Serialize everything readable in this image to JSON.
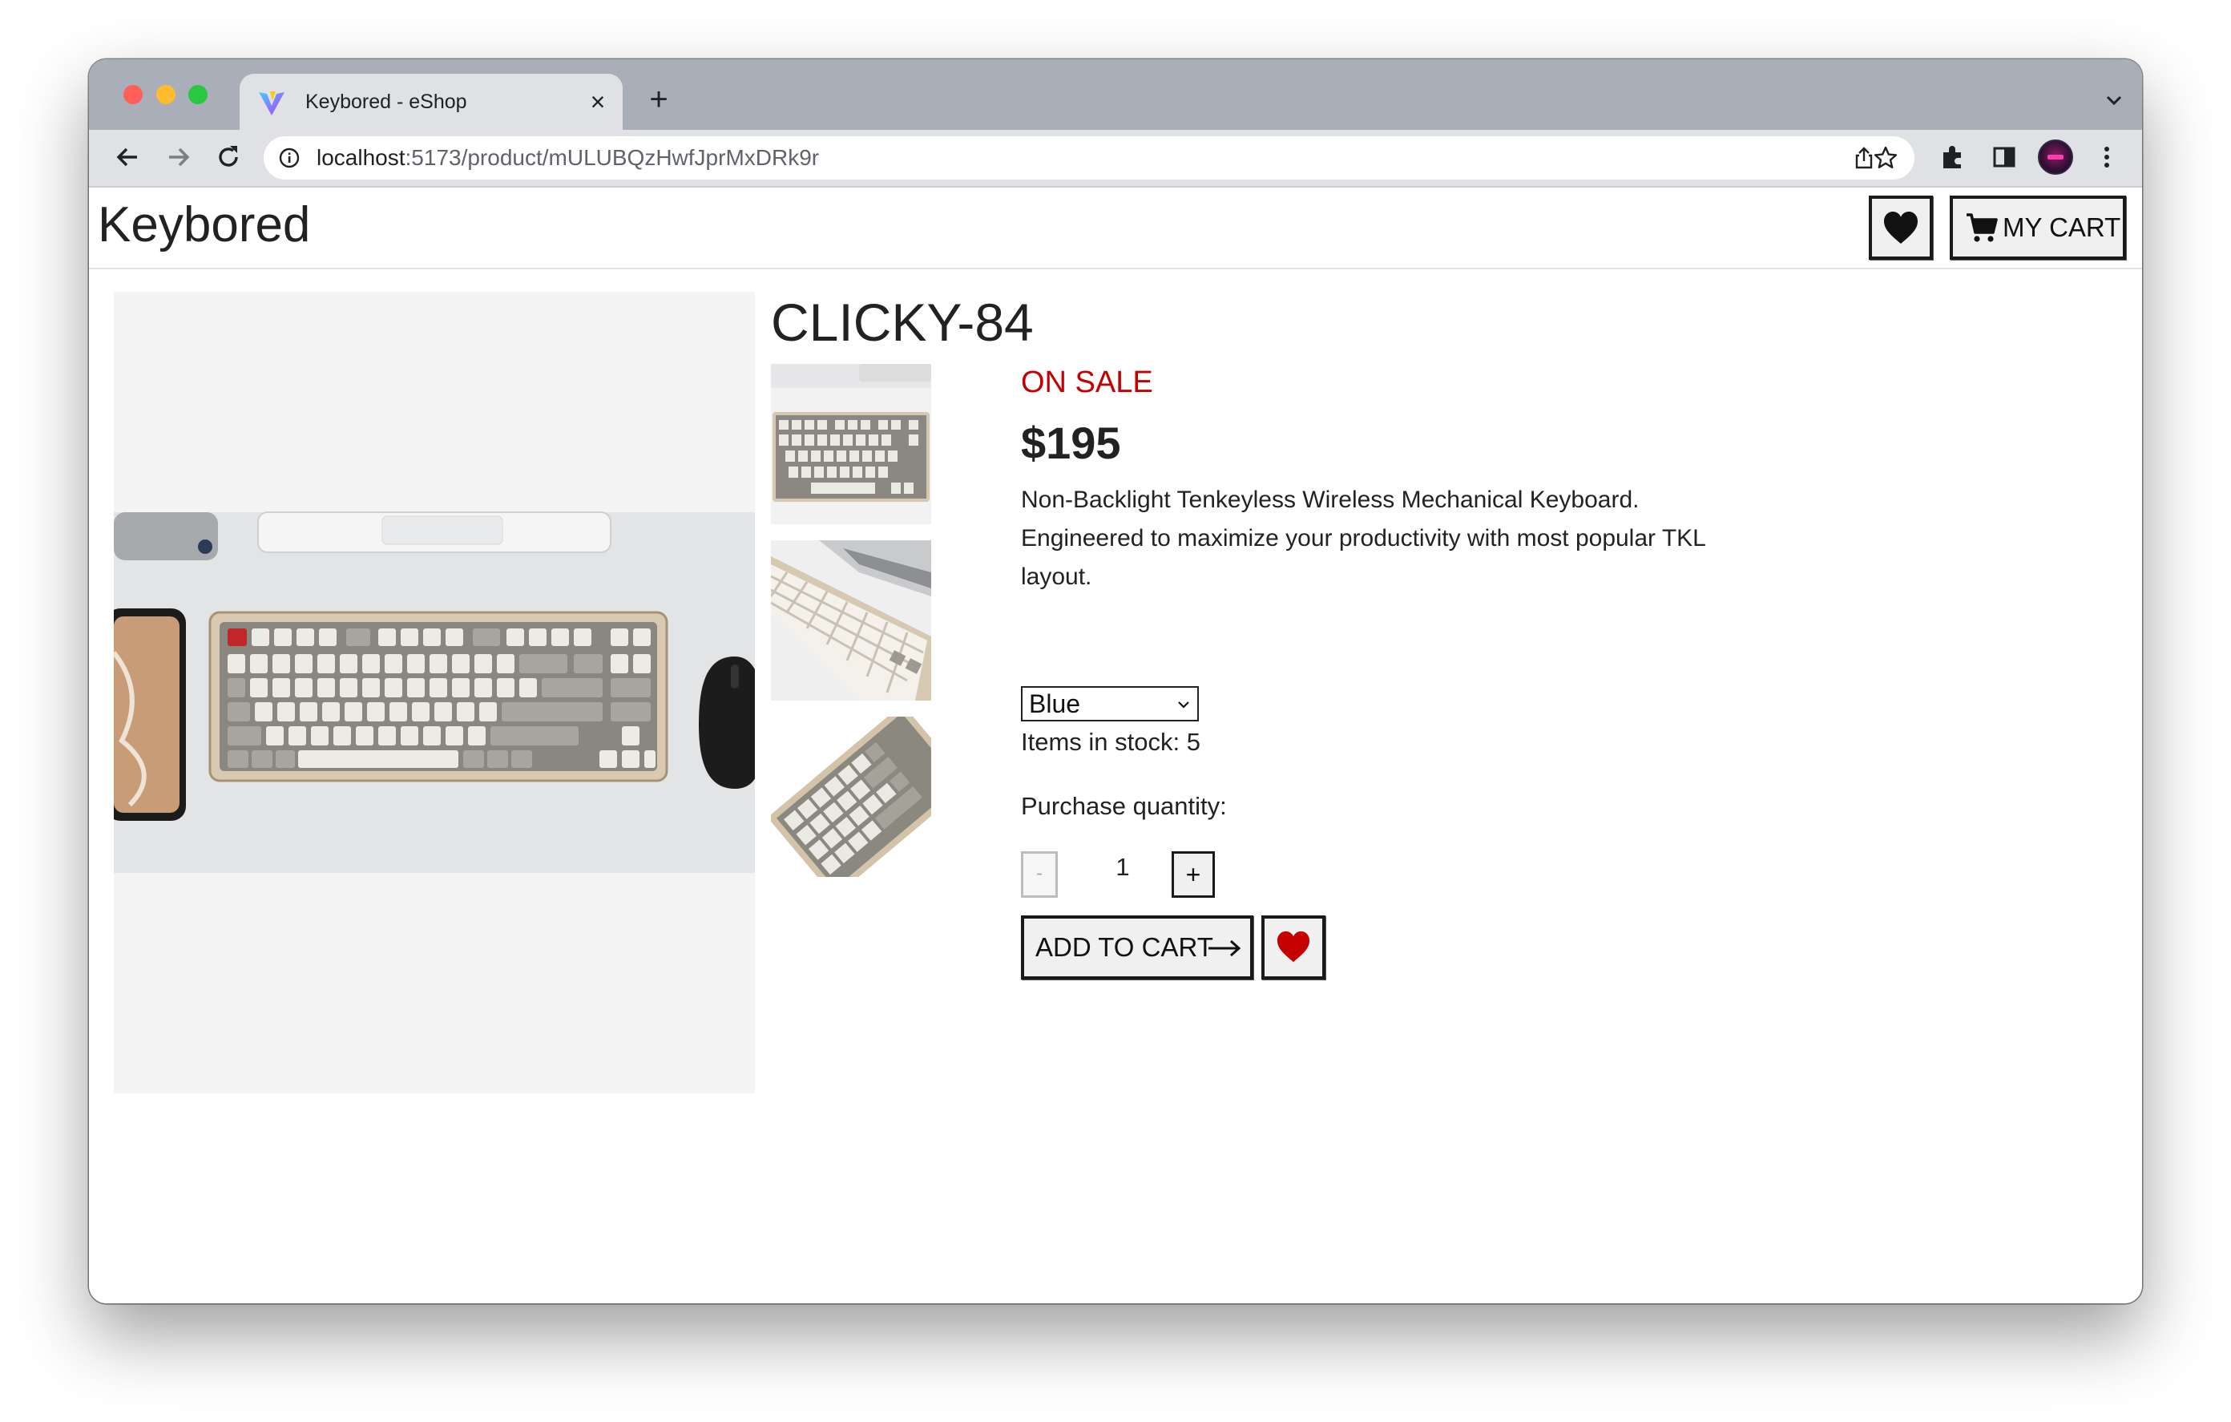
{
  "browser": {
    "tab_title": "Keybored - eShop",
    "tab_close": "×",
    "new_tab": "+",
    "url_host": "localhost",
    "url_path": ":5173/product/mULUBQzHwfJprMxDRk9r"
  },
  "header": {
    "site_title": "Keybored",
    "wishlist_icon": "heart-icon",
    "cart_icon": "cart-icon",
    "cart_label": "MY CART"
  },
  "product": {
    "title": "CLICKY-84",
    "sale_label": "ON SALE",
    "price": "$195",
    "description": "Non-Backlight Tenkeyless Wireless Mechanical Keyboard. Engineered to maximize your productivity with most popular TKL layout.",
    "variant_selected": "Blue",
    "stock_text": "Items in stock: 5",
    "quantity_label": "Purchase quantity:",
    "quantity_minus": "-",
    "quantity_value": "1",
    "quantity_plus": "+",
    "add_to_cart_label": "ADD TO CART"
  },
  "colors": {
    "sale": "#c40000",
    "wish_heart": "#c40000",
    "tab_strip": "#a9aeb8",
    "toolbar": "#dfe1e5"
  }
}
